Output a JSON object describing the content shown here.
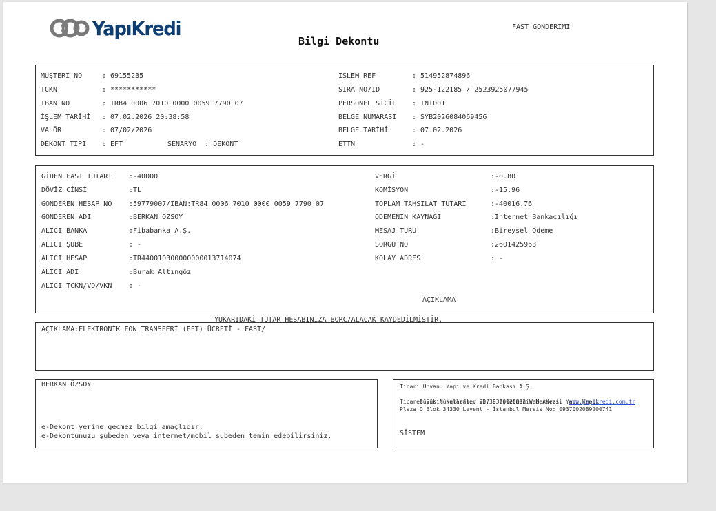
{
  "header": {
    "logo_text": "YapıKredi",
    "title": "Bilgi Dekontu",
    "type_label": "FAST GÖNDERİMİ"
  },
  "customer": {
    "left": [
      {
        "label": "MÜŞTERİ NO",
        "value": ": 69155235"
      },
      {
        "label": "TCKN",
        "value": ": ***********"
      },
      {
        "label": "IBAN NO",
        "value": ": TR84 0006 7010 0000 0059 7790 07"
      },
      {
        "label": "İŞLEM TARİHİ",
        "value": ": 07.02.2026 20:38:58"
      },
      {
        "label": "VALÖR",
        "value": ": 07/02/2026"
      },
      {
        "label": "DEKONT TİPİ",
        "value": ": EFT"
      }
    ],
    "scenario": "SENARYO  : DEKONT",
    "right": [
      {
        "label": "İŞLEM REF",
        "value": ": 514952874896"
      },
      {
        "label": "SIRA NO/ID",
        "value": ": 925-122185 / 2523925077945"
      },
      {
        "label": "PERSONEL SİCİL",
        "value": ": INT001"
      },
      {
        "label": "BELGE NUMARASI",
        "value": ": SYB2026084069456"
      },
      {
        "label": "BELGE TARİHİ",
        "value": ": 07.02.2026"
      },
      {
        "label": "ETTN",
        "value": ": -"
      }
    ]
  },
  "transfer": {
    "left": [
      {
        "label": "GİDEN FAST TUTARI",
        "value": ":-40000"
      },
      {
        "label": "DÖVİZ CİNSİ",
        "value": ":TL"
      },
      {
        "label": "GÖNDEREN HESAP NO",
        "value": ":59779007/IBAN:TR84 0006 7010 0000 0059 7790 07"
      },
      {
        "label": "GÖNDEREN ADI",
        "value": ":BERKAN ÖZSOY"
      },
      {
        "label": "ALICI BANKA",
        "value": ":Fibabanka A.Ş."
      },
      {
        "label": "ALICI ŞUBE",
        "value": ": -"
      },
      {
        "label": "ALICI HESAP",
        "value": ":TR440010300000000013714074"
      },
      {
        "label": "ALICI ADI",
        "value": ":Burak Altıngöz"
      },
      {
        "label": "ALICI TCKN/VD/VKN",
        "value": ": -"
      }
    ],
    "right": [
      {
        "label": "VERGİ",
        "value": ":-0.80"
      },
      {
        "label": "KOMİSYON",
        "value": ":-15.96"
      },
      {
        "label": "TOPLAM TAHSİLAT TUTARI",
        "value": ":-40016.76"
      },
      {
        "label": "ÖDEMENİN KAYNAĞI",
        "value": ":İnternet Bankacılığı"
      },
      {
        "label": "MESAJ TÜRÜ",
        "value": ":Bireysel Ödeme"
      },
      {
        "label": "SORGU NO",
        "value": ":2601425963"
      },
      {
        "label": "KOLAY ADRES",
        "value": ": -"
      }
    ],
    "description_heading": "AÇIKLAMA"
  },
  "notice": "YUKARIDAKİ TUTAR HESABINIZA BORÇ/ALACAK KAYDEDİLMİŞTİR.",
  "description": "AÇIKLAMA:ELEKTRONİK FON TRANSFERİ (EFT) ÜCRETİ - FAST/",
  "footer_left": {
    "name": "BERKAN ÖZSOY",
    "line1": "e-Dekont yerine geçmez bilgi amaçlıdır.",
    "line2": "e-Dekontunuzu şubeden veya internet/mobil şubeden temin edebilirsiniz."
  },
  "footer_right": {
    "line1": "Ticari Unvan: Yapı ve Kredi Bankası A.Ş.",
    "line2_prefix": "Büyük Mükellefler VD: 9370020892 Web Adresi: ",
    "website": "www.yapikredi.com.tr",
    "line3": "Ticaret Sicil Numarası: 32736 İşletmenin Merkezi: Yapı Kredi",
    "line4": "Plaza D Blok 34330 Levent - İstanbul Mersis No: 0937002089200741",
    "system": "SİSTEM"
  },
  "colors": {
    "brand": "#0f3e72",
    "logo_icon": "#7a7a7a",
    "link": "#2a4fc9"
  }
}
